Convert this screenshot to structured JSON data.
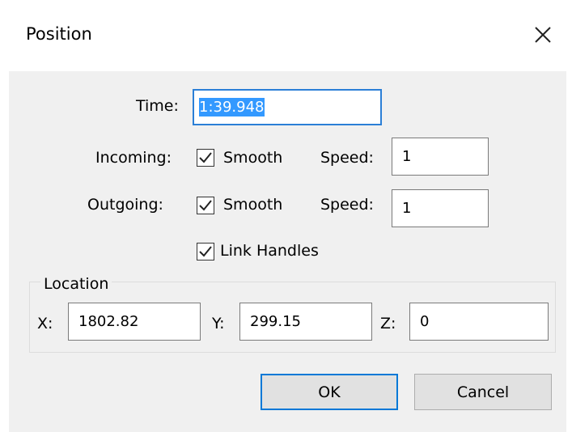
{
  "dialog": {
    "title": "Position"
  },
  "time": {
    "label": "Time:",
    "value": "1:39.948"
  },
  "incoming": {
    "label": "Incoming:",
    "smooth_label": "Smooth",
    "speed_label": "Speed:",
    "speed_value": "1"
  },
  "outgoing": {
    "label": "Outgoing:",
    "smooth_label": "Smooth",
    "speed_label": "Speed:",
    "speed_value": "1"
  },
  "link_handles": {
    "label": "Link Handles"
  },
  "location": {
    "label": "Location",
    "x_label": "X:",
    "x_value": "1802.82",
    "y_label": "Y:",
    "y_value": "299.15",
    "z_label": "Z:",
    "z_value": "0"
  },
  "buttons": {
    "ok": "OK",
    "cancel": "Cancel"
  },
  "colors": {
    "focus_border": "#2b7fd6",
    "selection": "#3399ff",
    "default_button_border": "#0078d7",
    "client_bg": "#f0f0f0"
  }
}
